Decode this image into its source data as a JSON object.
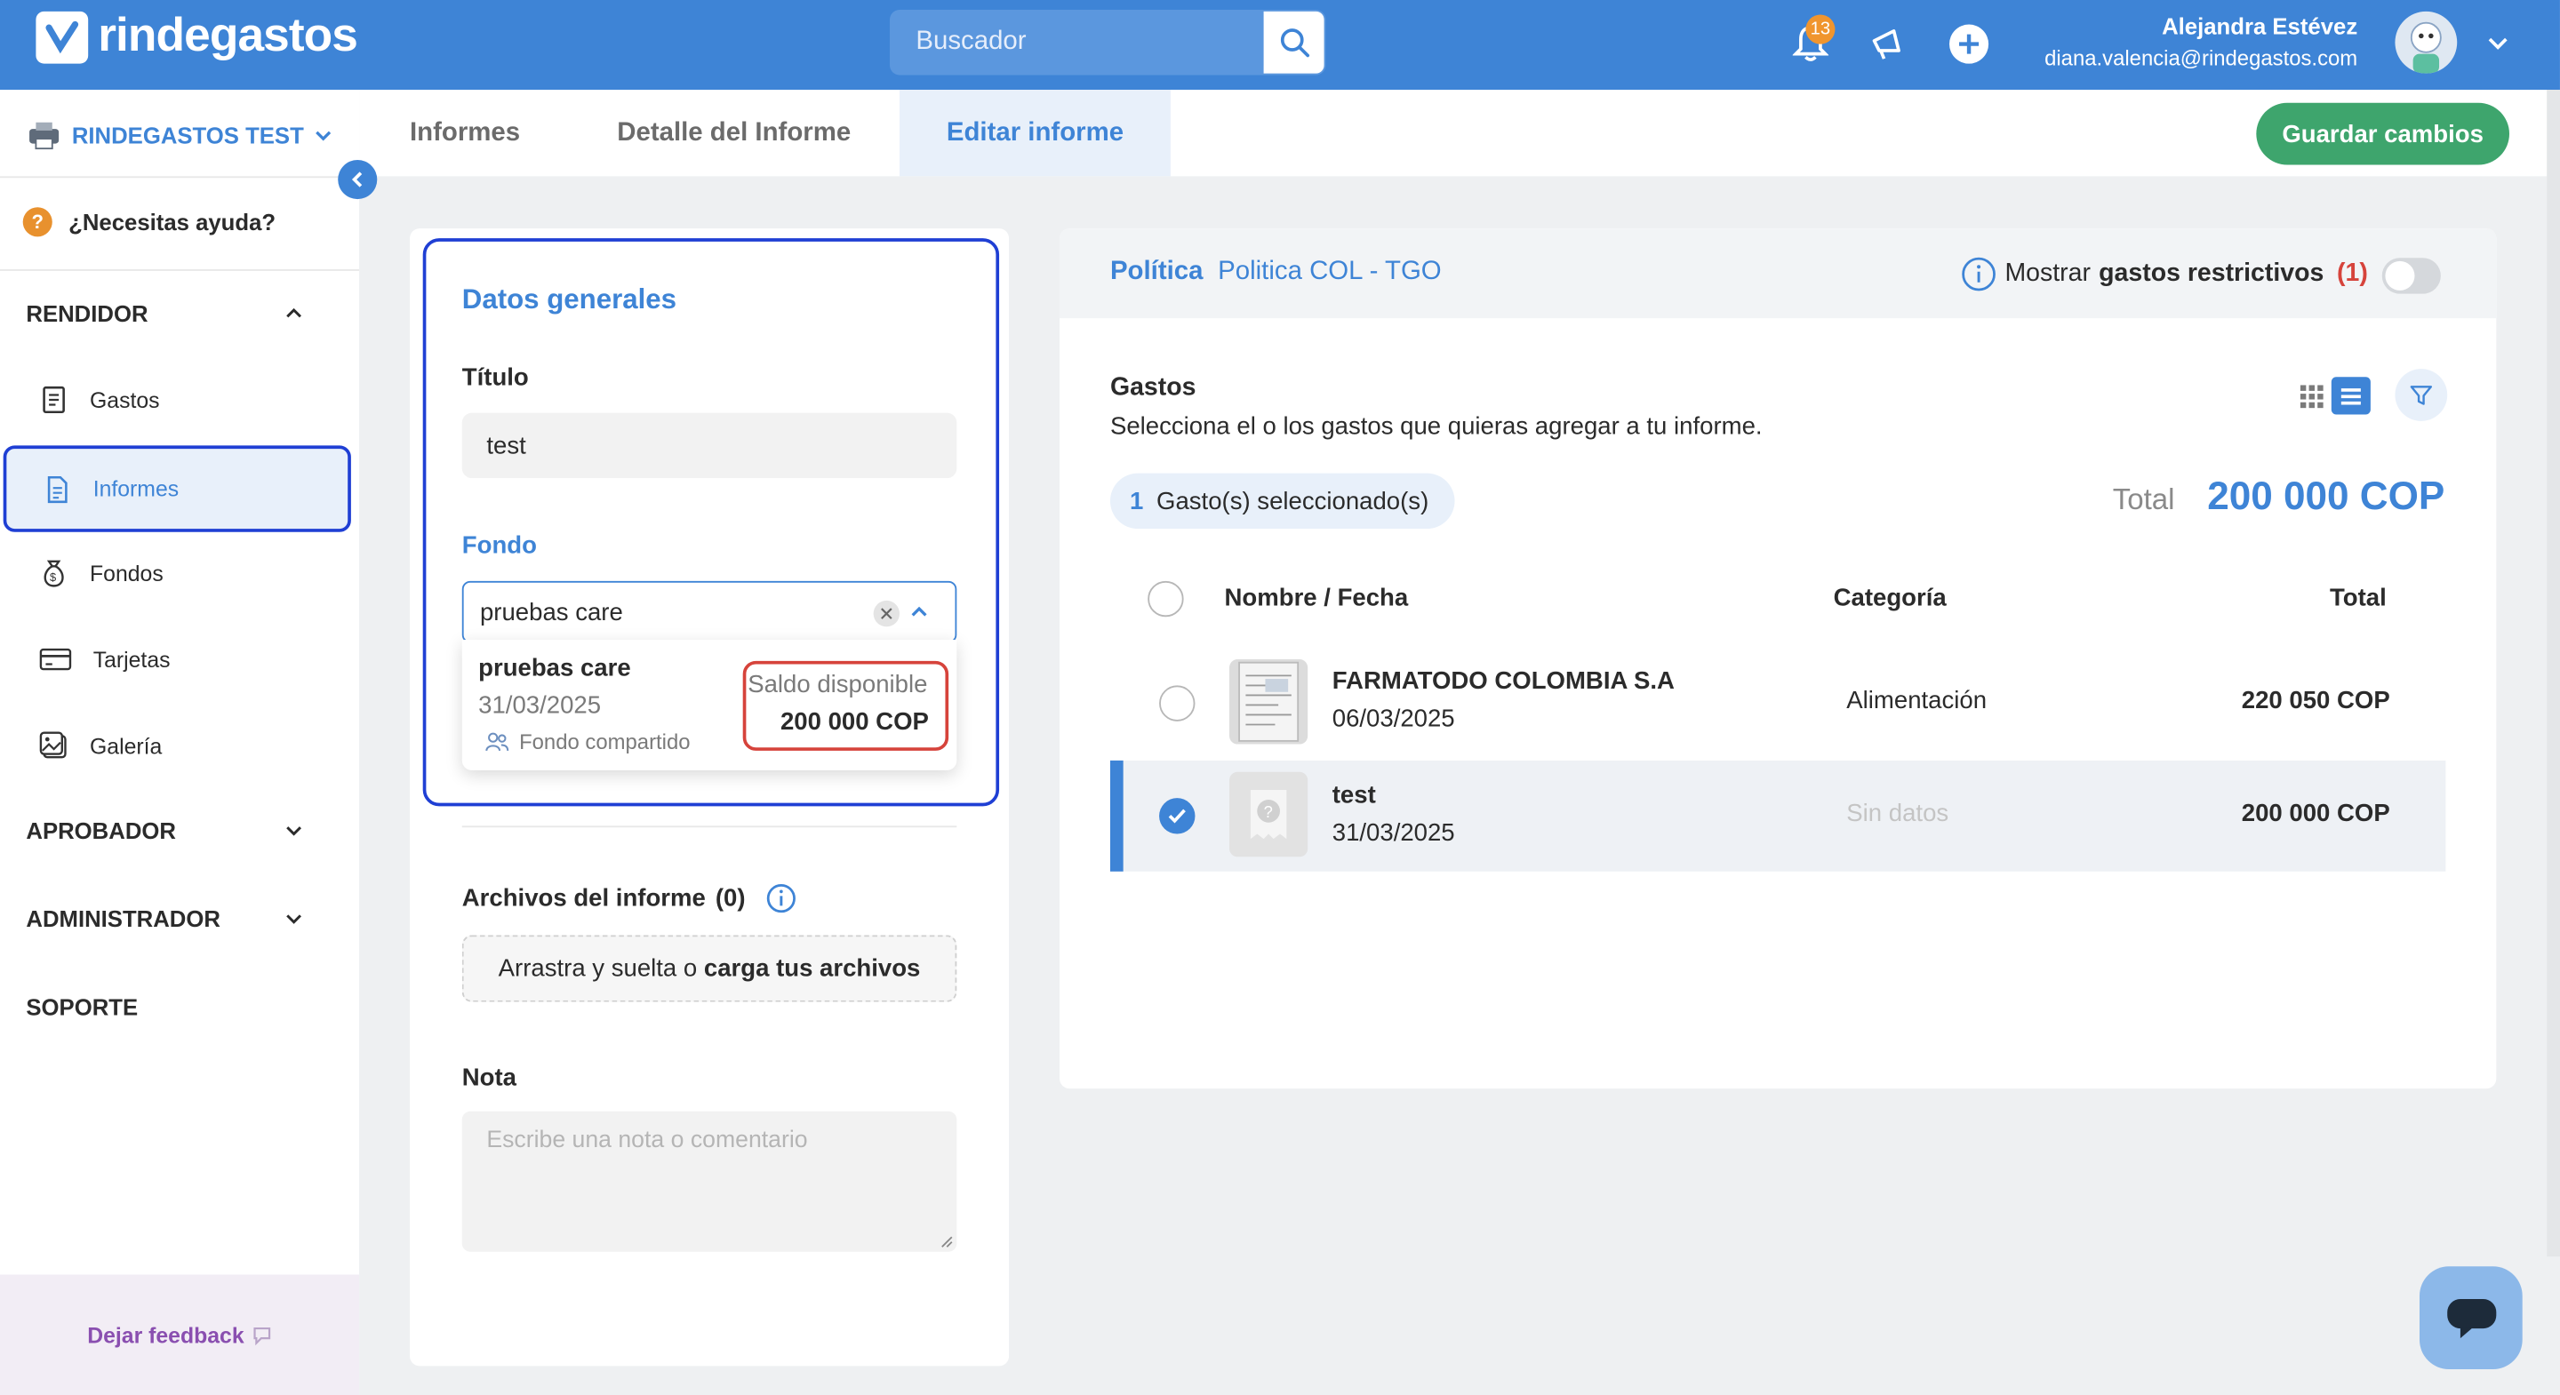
{
  "app": {
    "name": "rindegastos"
  },
  "search": {
    "placeholder": "Buscador"
  },
  "header": {
    "notifications_count": "13",
    "user_name": "Alejandra Estévez",
    "user_email": "diana.valencia@rindegastos.com"
  },
  "sidebar": {
    "company": "RINDEGASTOS TEST",
    "help": "¿Necesitas ayuda?",
    "sections": {
      "rendidor": "RENDIDOR",
      "aprobador": "APROBADOR",
      "administrador": "ADMINISTRADOR",
      "soporte": "SOPORTE"
    },
    "items": [
      {
        "label": "Gastos",
        "icon": "receipt-icon"
      },
      {
        "label": "Informes",
        "icon": "document-icon"
      },
      {
        "label": "Fondos",
        "icon": "money-bag-icon"
      },
      {
        "label": "Tarjetas",
        "icon": "card-icon"
      },
      {
        "label": "Galería",
        "icon": "gallery-icon"
      }
    ],
    "feedback": "Dejar feedback"
  },
  "tabs": [
    {
      "label": "Informes"
    },
    {
      "label": "Detalle del Informe"
    },
    {
      "label": "Editar informe",
      "active": true
    }
  ],
  "save_button": "Guardar cambios",
  "form": {
    "section_title": "Datos generales",
    "title_label": "Título",
    "title_value": "test",
    "fund_label": "Fondo",
    "fund_value": "pruebas care",
    "fund_option": {
      "name": "pruebas care",
      "date": "31/03/2025",
      "shared": "Fondo compartido",
      "balance_label": "Saldo disponible",
      "balance": "200 000 COP"
    },
    "files_label": "Archivos del informe",
    "files_count": "(0)",
    "upload_prefix": "Arrastra y suelta o",
    "upload_link": "carga tus archivos",
    "note_label": "Nota",
    "note_placeholder": "Escribe una nota o comentario"
  },
  "policy": {
    "label": "Política",
    "value": "Politica COL - TGO",
    "restrictive_prefix": "Mostrar",
    "restrictive_bold": "gastos restrictivos",
    "restrictive_count": "(1)"
  },
  "expenses": {
    "title": "Gastos",
    "subtitle": "Selecciona el o los gastos que quieras agregar a tu informe.",
    "selected_count": "1",
    "selected_label": "Gasto(s) seleccionado(s)",
    "total_label": "Total",
    "total_value": "200 000 COP",
    "columns": {
      "name": "Nombre / Fecha",
      "category": "Categoría",
      "total": "Total"
    },
    "rows": [
      {
        "name": "FARMATODO COLOMBIA S.A",
        "date": "06/03/2025",
        "category": "Alimentación",
        "total": "220 050 COP",
        "selected": false
      },
      {
        "name": "test",
        "date": "31/03/2025",
        "category": "Sin datos",
        "total": "200 000 COP",
        "selected": true
      }
    ]
  },
  "colors": {
    "primary": "#3e84d6",
    "success": "#3ea56d",
    "danger": "#d6433b",
    "highlight": "#1f3fd4"
  }
}
